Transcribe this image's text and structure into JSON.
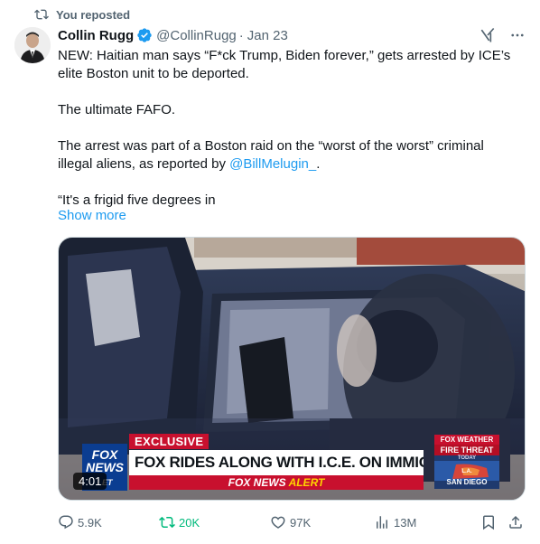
{
  "repost": {
    "label": "You reposted"
  },
  "author": {
    "name": "Collin Rugg",
    "handle": "@CollinRugg",
    "separator": "·",
    "date": "Jan 23"
  },
  "tweet": {
    "text1": "NEW: Haitian man says “F*ck Trump, Biden forever,” gets arrested by ICE’s elite Boston unit to be deported.",
    "text2": "The ultimate FAFO.",
    "text3_before": "The arrest was part of a Boston raid on the “worst of the worst” criminal illegal aliens, as reported by ",
    "text3_mention": "@BillMelugin_",
    "text3_after": ".",
    "text4": "“It's a frigid five degrees in",
    "show_more": "Show more"
  },
  "video": {
    "duration": "4:01",
    "chyron_exclusive": "EXCLUSIVE",
    "chyron_headline": "FOX RIDES ALONG WITH I.C.E. ON IMMIGRATION RAIDS",
    "chyron_alert_brand": "FOX NEWS",
    "chyron_alert_word": "ALERT",
    "logo_text": "FOX NEWS",
    "logo_sub": "LET",
    "weather_brand": "FOX WEATHER",
    "weather_threat": "FIRE THREAT",
    "weather_today": "TODAY",
    "weather_city": "SAN DIEGO",
    "weather_city_short": "L.A."
  },
  "actions": {
    "replies": "5.9K",
    "reposts": "20K",
    "likes": "97K",
    "views": "13M"
  },
  "icons": {
    "repost": "repost-icon",
    "verified": "verified-badge-icon",
    "grok": "grok-icon",
    "more": "more-icon",
    "reply": "reply-icon",
    "like": "like-icon",
    "views": "views-icon",
    "bookmark": "bookmark-icon",
    "share": "share-icon"
  },
  "colors": {
    "accent": "#1d9bf0",
    "muted": "#536471",
    "repost_active": "#00ba7c",
    "fox_red": "#c8102e",
    "fox_blue": "#0b3d91"
  }
}
